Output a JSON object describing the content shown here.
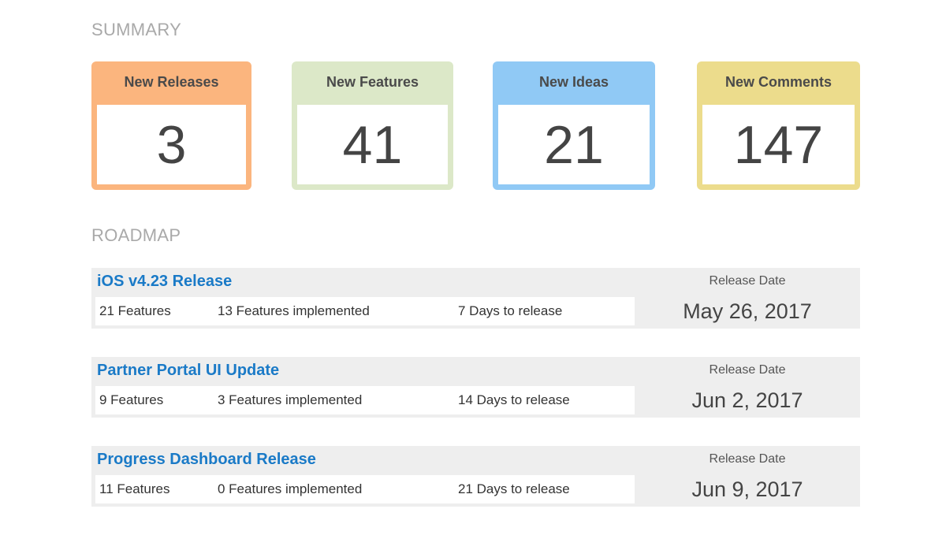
{
  "summary": {
    "title": "SUMMARY",
    "cards": [
      {
        "label": "New Releases",
        "value": "3",
        "color": "#fbb57e"
      },
      {
        "label": "New Features",
        "value": "41",
        "color": "#dce8c8"
      },
      {
        "label": "New Ideas",
        "value": "21",
        "color": "#90c9f5"
      },
      {
        "label": "New Comments",
        "value": "147",
        "color": "#ecdc8c"
      }
    ]
  },
  "roadmap": {
    "title": "ROADMAP",
    "releases": [
      {
        "name": "iOS v4.23 Release",
        "features": "21 Features",
        "implemented": "13 Features implemented",
        "days": "7 Days to release",
        "date_label": "Release Date",
        "date": "May 26, 2017"
      },
      {
        "name": "Partner Portal UI Update",
        "features": "9 Features",
        "implemented": "3 Features implemented",
        "days": "14 Days to release",
        "date_label": "Release Date",
        "date": "Jun 2, 2017"
      },
      {
        "name": "Progress Dashboard Release",
        "features": "11 Features",
        "implemented": "0 Features implemented",
        "days": "21 Days to release",
        "date_label": "Release Date",
        "date": "Jun 9, 2017"
      }
    ]
  }
}
